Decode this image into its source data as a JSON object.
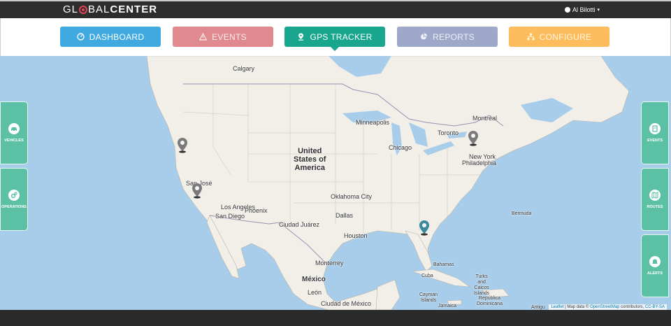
{
  "brand": {
    "logo_part1": "GL",
    "logo_part2": "BAL",
    "logo_part3": "CENTER"
  },
  "user": {
    "name": "Al Bilotti"
  },
  "nav": [
    {
      "label": "DASHBOARD",
      "icon": "dashboard-icon"
    },
    {
      "label": "EVENTS",
      "icon": "warning-icon"
    },
    {
      "label": "GPS TRACKER",
      "icon": "map-pin-icon",
      "active": true
    },
    {
      "label": "REPORTS",
      "icon": "pie-chart-icon"
    },
    {
      "label": "CONFIGURE",
      "icon": "sitemap-icon"
    }
  ],
  "left_tabs": [
    {
      "label": "VEHICLES",
      "icon": "car-icon"
    },
    {
      "label": "OPERATIONS",
      "icon": "gears-icon"
    }
  ],
  "right_tabs": [
    {
      "label": "EVENTS",
      "icon": "events-icon"
    },
    {
      "label": "ROUTES",
      "icon": "map-icon"
    },
    {
      "label": "ALERTS",
      "icon": "alert-icon"
    }
  ],
  "map": {
    "labels": {
      "calgary": "Calgary",
      "montreal": "Montréal",
      "toronto": "Toronto",
      "minneapolis": "Minneapolis",
      "chicago": "Chicago",
      "new_york": "New York",
      "philadelphia": "Philadelphia",
      "usa_1": "United",
      "usa_2": "States of",
      "usa_3": "America",
      "san_jose": "San José",
      "los_angeles": "Los Angeles",
      "phoenix": "Phoenix",
      "san_diego": "San Diego",
      "ciudad_juarez": "Ciudad Juárez",
      "oklahoma_city": "Oklahoma City",
      "dallas": "Dallas",
      "houston": "Houston",
      "bermuda": "Bermuda",
      "bahamas": "Bahamas",
      "monterrey": "Monterrey",
      "mexico": "México",
      "leon": "León",
      "ciudad_de_mexico": "Ciudad de México",
      "cuba": "Cuba",
      "turks_1": "Turks",
      "turks_2": "and",
      "turks_3": "Caicos",
      "turks_4": "Islands",
      "cayman_1": "Cayman",
      "cayman_2": "Islands",
      "jamaica": "Jamaica",
      "dominicana_1": "República",
      "dominicana_2": "Dominicana",
      "antigua": "Antigu"
    },
    "attribution": {
      "leaflet": "Leaflet",
      "text": " | Map data © ",
      "osm": "OpenStreetMap",
      "contrib": " contributors, ",
      "license": "CC-BY-SA"
    }
  },
  "colors": {
    "dashboard": "#3fa9e0",
    "events": "#e08a8f",
    "gps": "#18a78e",
    "reports": "#9ea9c9",
    "configure": "#fdbd5c",
    "sidetab": "#5cc1a4",
    "water": "#a8cdea",
    "land": "#f2efe9"
  }
}
